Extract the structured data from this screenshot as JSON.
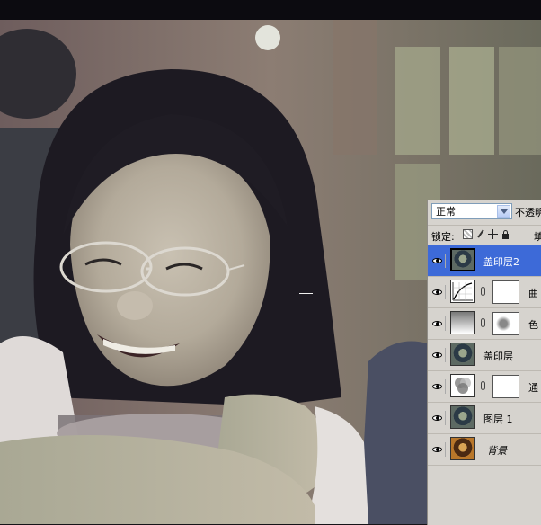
{
  "canvas": {
    "name": "photo-canvas"
  },
  "layers_panel": {
    "blend_mode": "正常",
    "opacity_label": "不透明",
    "lock_label": "锁定:",
    "fill_label": "填",
    "lock_icons": [
      "lock-transparent-icon",
      "lock-image-icon",
      "lock-position-icon",
      "lock-all-icon"
    ],
    "layers": [
      {
        "name": "盖印层2",
        "thumbnail": "photo",
        "selected": true
      },
      {
        "name": "曲",
        "thumbnail": "curves-adjustment",
        "has_mask": true
      },
      {
        "name": "色",
        "thumbnail": "gradient-adjustment",
        "has_mask": true
      },
      {
        "name": "盖印层",
        "thumbnail": "photo"
      },
      {
        "name": "通",
        "thumbnail": "channel-mixer-adjustment",
        "has_mask": true
      },
      {
        "name": "图层 1",
        "thumbnail": "photo"
      },
      {
        "name": "背景",
        "thumbnail": "photo-original",
        "italic": true
      }
    ]
  },
  "colors": {
    "selection": "#3d6ad8",
    "panel_bg": "#d6d3ce"
  }
}
